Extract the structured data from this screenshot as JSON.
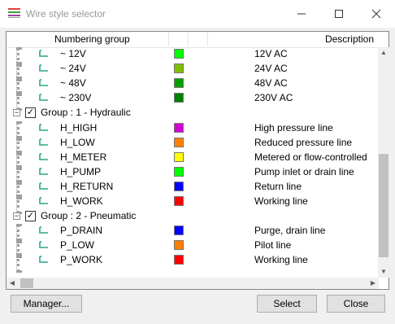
{
  "window": {
    "title": "Wire style selector"
  },
  "columns": {
    "numbering_group": "Numbering group",
    "description": "Description"
  },
  "rows": [
    {
      "kind": "leaf",
      "name": "~ 12V",
      "color": "#00ff00",
      "desc": "12V AC",
      "icon": "tree-leaf-icon"
    },
    {
      "kind": "leaf",
      "name": "~ 24V",
      "color": "#80c000",
      "desc": "24V AC",
      "icon": "tree-leaf-icon"
    },
    {
      "kind": "leaf",
      "name": "~ 48V",
      "color": "#00a000",
      "desc": "48V AC",
      "icon": "tree-leaf-icon"
    },
    {
      "kind": "leaf",
      "name": "~ 230V",
      "color": "#008000",
      "desc": "230V AC",
      "icon": "tree-leaf-icon"
    },
    {
      "kind": "group",
      "name": "Group : 1 - Hydraulic",
      "checked": true
    },
    {
      "kind": "leaf",
      "name": "H_HIGH",
      "color": "#d000d0",
      "desc": "High pressure line",
      "icon": "tree-leaf-icon"
    },
    {
      "kind": "leaf",
      "name": "H_LOW",
      "color": "#ff8000",
      "desc": "Reduced pressure line",
      "icon": "tree-leaf-icon"
    },
    {
      "kind": "leaf",
      "name": "H_METER",
      "color": "#ffff00",
      "desc": "Metered or flow-controlled",
      "icon": "tree-leaf-icon"
    },
    {
      "kind": "leaf",
      "name": "H_PUMP",
      "color": "#00ff00",
      "desc": "Pump inlet or drain line",
      "icon": "tree-leaf-icon"
    },
    {
      "kind": "leaf",
      "name": "H_RETURN",
      "color": "#0000ff",
      "desc": "Return line",
      "icon": "tree-leaf-icon"
    },
    {
      "kind": "leaf",
      "name": "H_WORK",
      "color": "#ff0000",
      "desc": "Working line",
      "icon": "tree-leaf-icon"
    },
    {
      "kind": "group",
      "name": "Group : 2 - Pneumatic",
      "checked": true
    },
    {
      "kind": "leaf",
      "name": "P_DRAIN",
      "color": "#0000ff",
      "desc": "Purge, drain line",
      "icon": "tree-leaf-icon"
    },
    {
      "kind": "leaf",
      "name": "P_LOW",
      "color": "#ff8000",
      "desc": "Pilot line",
      "icon": "tree-leaf-icon"
    },
    {
      "kind": "leaf",
      "name": "P_WORK",
      "color": "#ff0000",
      "desc": "Working line",
      "icon": "tree-leaf-icon"
    }
  ],
  "buttons": {
    "manager": "Manager...",
    "select": "Select",
    "close": "Close"
  }
}
